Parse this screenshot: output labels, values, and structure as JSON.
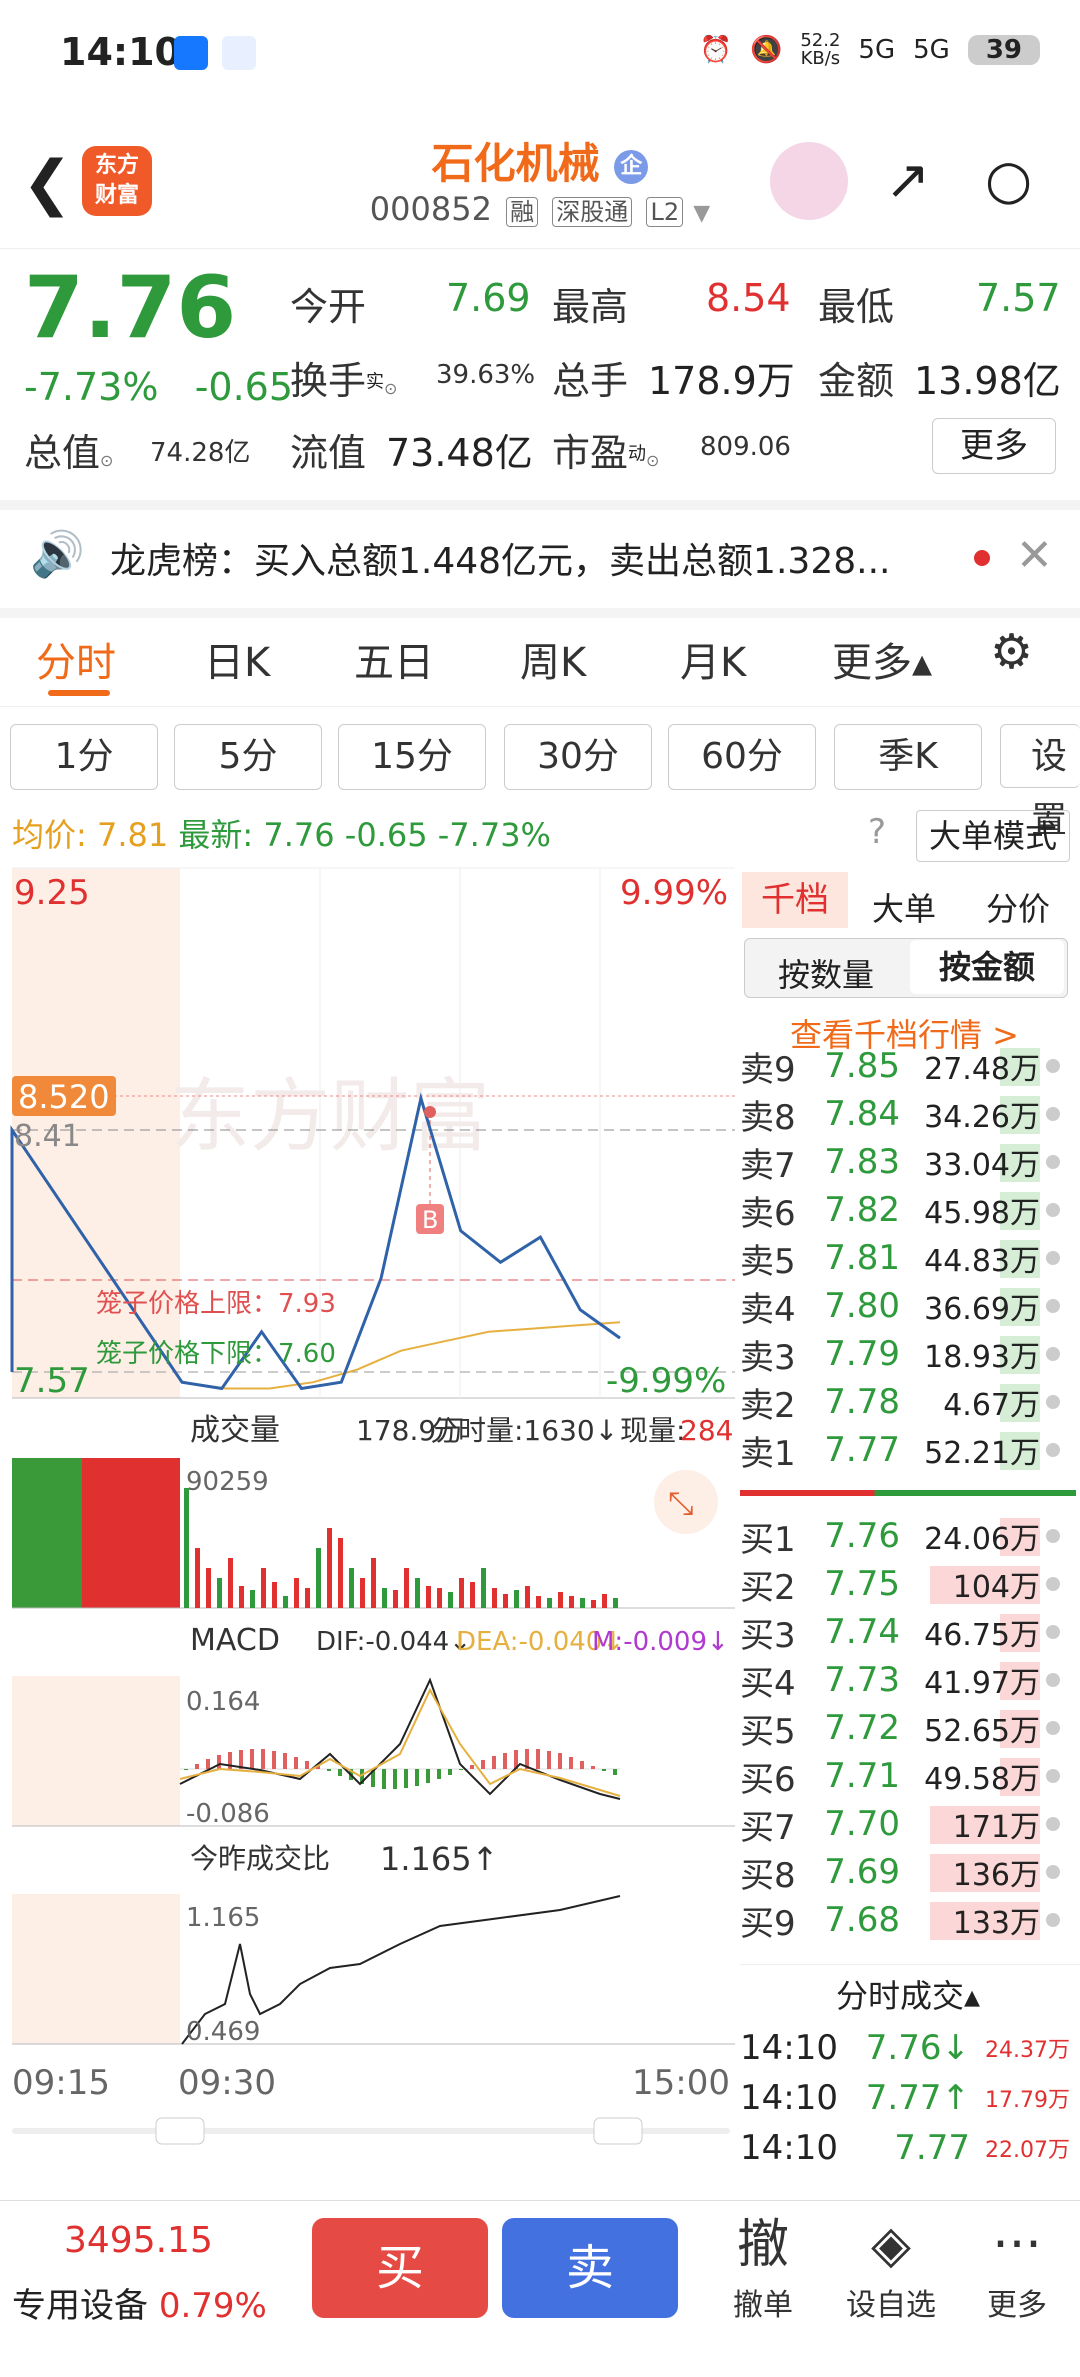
{
  "status_bar": {
    "time": "14:10",
    "net_speed_top": "52.2",
    "net_speed_bottom": "KB/s",
    "signal1": "5G",
    "signal2": "5G",
    "battery": "39"
  },
  "header": {
    "logo_line1": "东方",
    "logo_line2": "财富",
    "title": "石化机械",
    "title_badge": "企",
    "code": "000852",
    "tags": [
      "融",
      "深股通",
      "L2"
    ]
  },
  "quote": {
    "price": "7.76",
    "change_pct": "-7.73%",
    "change": "-0.65",
    "open_label": "今开",
    "open": "7.69",
    "high_label": "最高",
    "high": "8.54",
    "low_label": "最低",
    "low": "7.57",
    "turnover_label": "换手",
    "turnover_sup": "实",
    "turnover": "39.63%",
    "volume_label": "总手",
    "volume": "178.9万",
    "amount_label": "金额",
    "amount": "13.98亿",
    "mktcap_label": "总值",
    "mktcap": "74.28亿",
    "float_label": "流值",
    "float": "73.48亿",
    "pe_label": "市盈",
    "pe_sup": "动",
    "pe": "809.06",
    "more": "更多"
  },
  "notice": {
    "text": "龙虎榜：买入总额1.448亿元，卖出总额1.328..."
  },
  "tabs": [
    "分时",
    "日K",
    "五日",
    "周K",
    "月K",
    "更多▴"
  ],
  "periods": [
    "1分",
    "5分",
    "15分",
    "30分",
    "60分",
    "季K",
    "设置"
  ],
  "info": {
    "avg_label": "均价:",
    "avg": "7.81",
    "latest_label": "最新:",
    "latest": "7.76",
    "chg": "-0.65",
    "pct": "-7.73%",
    "big_order_btn": "大单模式"
  },
  "chart": {
    "top_price": "9.25",
    "top_pct": "9.99%",
    "line_price": "8.520",
    "ref_price": "8.41",
    "low_price": "7.57",
    "low_pct": "-9.99%",
    "cage_upper": "笼子价格上限：7.93",
    "cage_lower": "笼子价格下限：7.60",
    "watermark": "东方财富",
    "marker": "B",
    "vol_label": "成交量",
    "vol_total": "178.9万",
    "vol_count": "分时量:1630↓",
    "vol_now_label": "现量:",
    "vol_now": "284",
    "vol_max": "90259",
    "macd_label": "MACD",
    "dif": "DIF:-0.044↓",
    "dea": "DEA:-0.040↓",
    "m": "M:-0.009↓",
    "macd_top": "0.164",
    "macd_bot": "-0.086",
    "ratio_label": "今昨成交比",
    "ratio_val": "1.165↑",
    "ratio_top": "1.165",
    "ratio_bot": "0.469",
    "t_start": "09:15",
    "t_mid": "09:30",
    "t_end": "15:00"
  },
  "chart_data": {
    "type": "line",
    "ylim": [
      7.57,
      9.25
    ],
    "series": [
      {
        "name": "均价",
        "values": [
          7.62,
          7.6,
          7.6,
          7.62,
          7.66,
          7.72,
          7.75,
          7.78,
          7.79,
          7.8,
          7.81
        ]
      }
    ],
    "price_values": [
      7.62,
      7.6,
      7.78,
      7.6,
      7.62,
      7.95,
      8.52,
      8.1,
      8.0,
      8.08,
      7.85,
      7.76
    ]
  },
  "orderbook": {
    "tabs": [
      "千档",
      "大单",
      "分价"
    ],
    "sub_tabs": [
      "按数量",
      "按金额"
    ],
    "link": "查看千档行情 >",
    "sells": [
      {
        "label": "卖9",
        "price": "7.85",
        "vol": "27.48万"
      },
      {
        "label": "卖8",
        "price": "7.84",
        "vol": "34.26万"
      },
      {
        "label": "卖7",
        "price": "7.83",
        "vol": "33.04万"
      },
      {
        "label": "卖6",
        "price": "7.82",
        "vol": "45.98万"
      },
      {
        "label": "卖5",
        "price": "7.81",
        "vol": "44.83万"
      },
      {
        "label": "卖4",
        "price": "7.80",
        "vol": "36.69万"
      },
      {
        "label": "卖3",
        "price": "7.79",
        "vol": "18.93万"
      },
      {
        "label": "卖2",
        "price": "7.78",
        "vol": "4.67万"
      },
      {
        "label": "卖1",
        "price": "7.77",
        "vol": "52.21万"
      }
    ],
    "buys": [
      {
        "label": "买1",
        "price": "7.76",
        "vol": "24.06万"
      },
      {
        "label": "买2",
        "price": "7.75",
        "vol": "104万"
      },
      {
        "label": "买3",
        "price": "7.74",
        "vol": "46.75万"
      },
      {
        "label": "买4",
        "price": "7.73",
        "vol": "41.97万"
      },
      {
        "label": "买5",
        "price": "7.72",
        "vol": "52.65万"
      },
      {
        "label": "买6",
        "price": "7.71",
        "vol": "49.58万"
      },
      {
        "label": "买7",
        "price": "7.70",
        "vol": "171万"
      },
      {
        "label": "买8",
        "price": "7.69",
        "vol": "136万"
      },
      {
        "label": "买9",
        "price": "7.68",
        "vol": "133万"
      }
    ],
    "trades_title": "分时成交▴",
    "trades": [
      {
        "time": "14:10",
        "price": "7.76↓",
        "vol": "24.37万"
      },
      {
        "time": "14:10",
        "price": "7.77↑",
        "vol": "17.79万"
      },
      {
        "time": "14:10",
        "price": "7.77",
        "vol": "22.07万"
      }
    ]
  },
  "bottom": {
    "index": "3495.15",
    "sector": "专用设备",
    "sector_pct": "0.79%",
    "buy": "买",
    "sell": "卖",
    "cancel": "撤单",
    "watch": "设自选",
    "more": "更多",
    "cancel_glyph": "撤"
  }
}
